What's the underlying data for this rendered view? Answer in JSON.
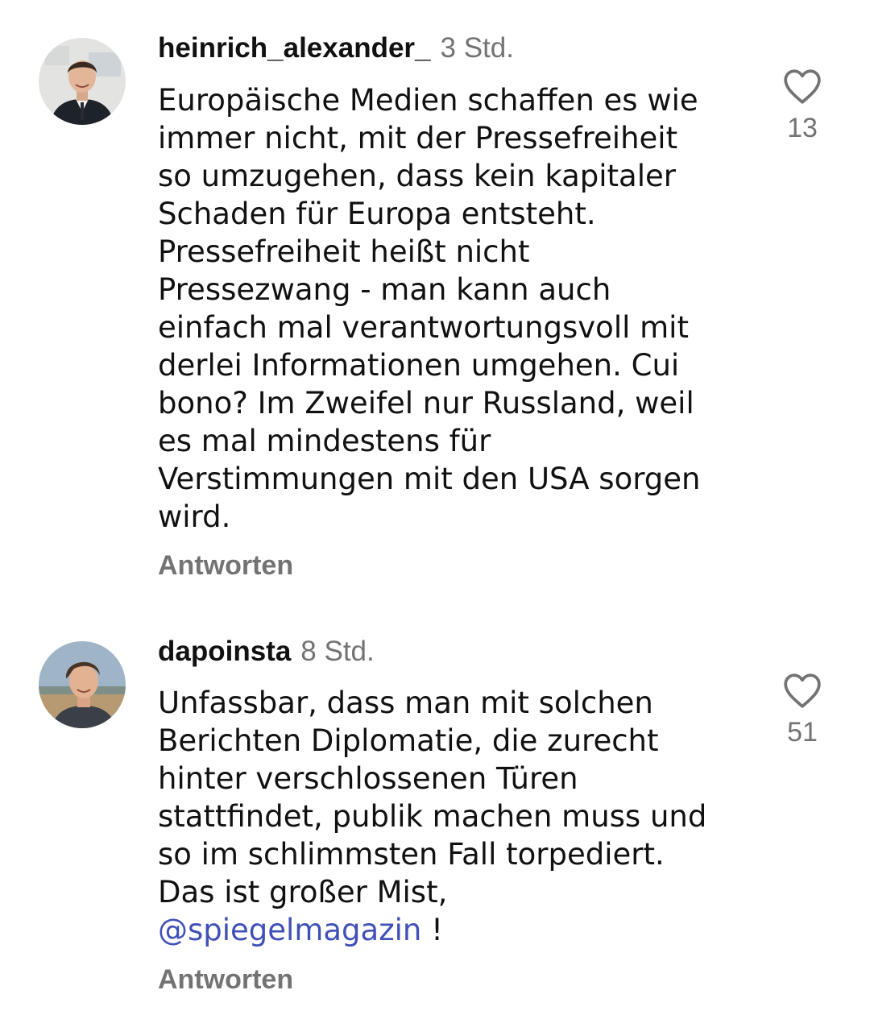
{
  "comments": [
    {
      "username": "heinrich_alexander_",
      "time": "3 Std.",
      "lines": [
        "Europäische Medien schaffen es wie",
        "immer nicht, mit der Pressefreiheit",
        "so umzugehen, dass kein kapitaler",
        "Schaden für Europa entsteht.",
        "Pressefreiheit heißt nicht",
        "Pressezwang - man kann auch",
        "einfach mal verantwortungsvoll mit",
        "derlei Informationen umgehen. Cui",
        "bono? Im Zweifel nur Russland, weil",
        "es mal mindestens für",
        "Verstimmungen mit den USA sorgen",
        "wird."
      ],
      "reply_label": "Antworten",
      "likes": "13",
      "like_icon": "heart-outline-icon"
    },
    {
      "username": "dapoinsta",
      "time": "8 Std.",
      "lines": [
        "Unfassbar, dass man mit solchen",
        "Berichten Diplomatie, die zurecht",
        "hinter verschlossenen Türen",
        "stattfindet, publik machen muss und",
        "so im schlimmsten Fall torpediert.",
        "Das ist großer Mist,"
      ],
      "mention": "@spiegelmagazin",
      "mention_suffix": " !",
      "reply_label": "Antworten",
      "likes": "51",
      "like_icon": "heart-outline-icon"
    }
  ],
  "colors": {
    "text": "#111111",
    "secondary": "#737373",
    "mention": "#4150b8",
    "background": "#ffffff"
  }
}
